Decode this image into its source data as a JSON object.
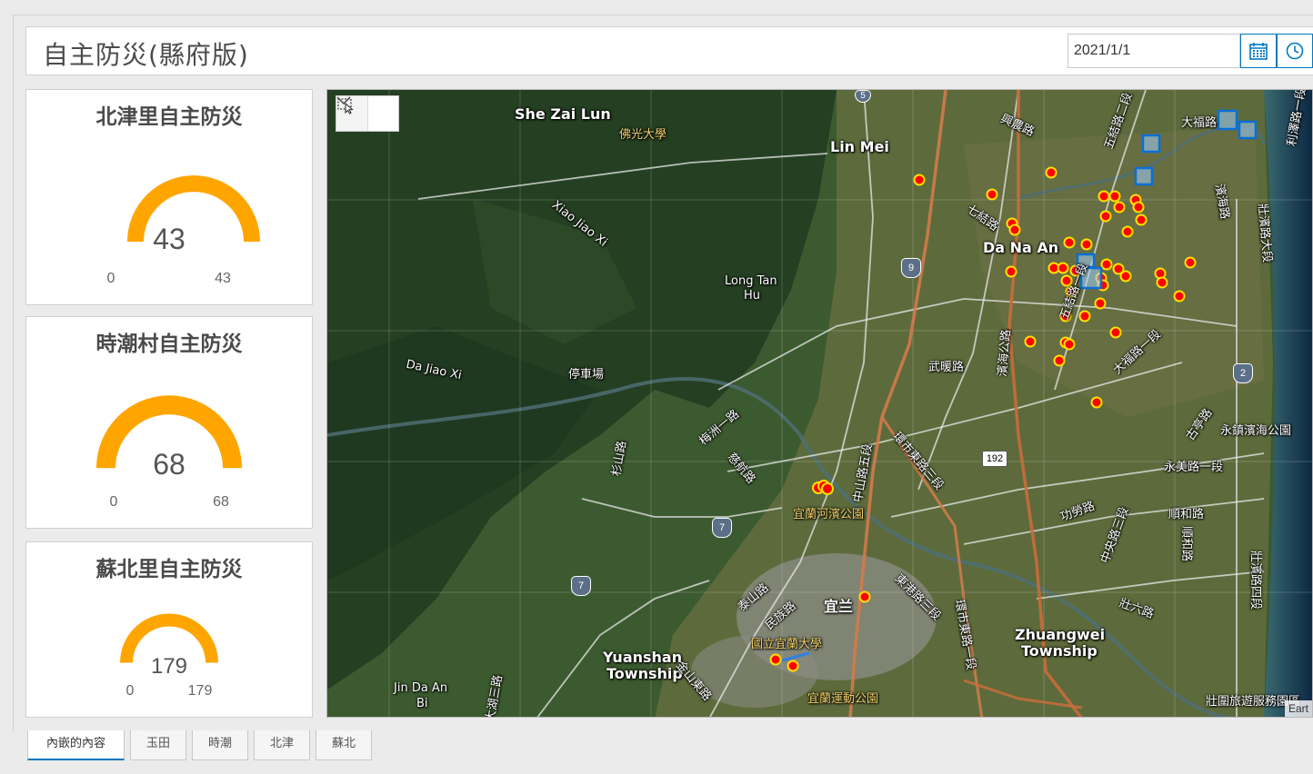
{
  "header": {
    "title": "自主防災(縣府版)",
    "date_value": "2021/1/1",
    "calendar_icon": "calendar-icon",
    "clock_icon": "clock-icon",
    "accent_color": "#0079c1"
  },
  "gauges": [
    {
      "title": "北津里自主防災",
      "value": "43",
      "min": "0",
      "max": "43",
      "fill_fraction": 1.0,
      "color": "#ffa500"
    },
    {
      "title": "時潮村自主防災",
      "value": "68",
      "min": "0",
      "max": "68",
      "fill_fraction": 1.0,
      "color": "#ffa500"
    },
    {
      "title": "蘇北里自主防災",
      "value": "179",
      "min": "0",
      "max": "179",
      "fill_fraction": 1.0,
      "color": "#ffa500"
    }
  ],
  "map": {
    "labels": {
      "she_zai_lun": "She Zai Lun",
      "fo_guang": "佛光大學",
      "lin_mei": "Lin Mei",
      "xiao_jiao_xi": "Xiao Jiao Xi",
      "long_tan_hu_1": "Long Tan",
      "long_tan_hu_2": "Hu",
      "da_jiao_xi": "Da Jiao Xi",
      "parking": "停車場",
      "da_na_an": "Da Na An",
      "xing_nong": "興農路",
      "da_fu_road": "大福路",
      "qi_jie": "七結路",
      "wu_jie_2": "五結路二段",
      "wu_jie_1": "五結路一段",
      "li_ze_1": "利澤路一段",
      "bin_hai": "濱海路",
      "bin_hai_da": "壯濱路大段",
      "wu_nuan": "武暖路",
      "bin_shui_gong": "濱海公路",
      "da_fu_1": "大福路一段",
      "gu_ting": "古亭路",
      "yong_zhen": "永鎮濱海公園",
      "yong_mei": "永美路一段",
      "ring_east_3": "環市東路三段",
      "zhong_shan_5": "中山路五段",
      "yilan_river_park": "宜蘭河濱公園",
      "mei_zhou": "梅洲一路",
      "ci_hang": "慈航路",
      "shan_lu": "杉山路",
      "gong_lao": "功勞路",
      "zhong_yang_3": "中央路三段",
      "shun_he": "順和路",
      "zhuang_bin_4": "壯濱路四段",
      "tai_shan": "泰山路",
      "min_zu": "民族路",
      "yilan": "宜兰",
      "dong_gang_3": "東港路三段",
      "ring_east_1": "環市東路一段",
      "zhuangwei_1": "Zhuangwei",
      "zhuangwei_2": "Township",
      "zhuang_liu": "壯六路",
      "niu": "國立宜蘭大學",
      "yuanshan_1": "Yuanshan",
      "yuanshan_2": "Township",
      "jin_shan_east": "金山東路",
      "sports_park": "宜蘭運動公園",
      "jin_da_an_1": "Jin Da An",
      "jin_da_an_2": "Bi",
      "da_hu_3": "大湖三路",
      "zhuang_wei_tour": "壯圍旅遊服務園區",
      "attribution": "Eart"
    },
    "shields": {
      "s5": "5",
      "s9": "9",
      "s2": "2",
      "s7a": "7",
      "s7b": "7",
      "s192": "192"
    },
    "point_color": "#ff0000",
    "point_outline": "#ffe000"
  },
  "tabs": [
    {
      "label": "內嵌的內容",
      "active": true
    },
    {
      "label": "玉田",
      "active": false
    },
    {
      "label": "時潮",
      "active": false
    },
    {
      "label": "北津",
      "active": false
    },
    {
      "label": "蘇北",
      "active": false
    }
  ]
}
